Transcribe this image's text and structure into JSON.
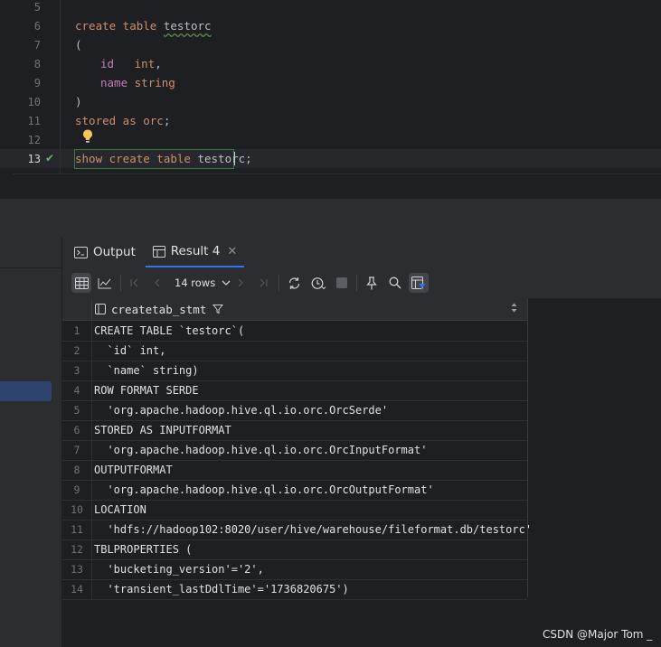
{
  "editor": {
    "line_numbers": [
      "5",
      "6",
      "7",
      "8",
      "9",
      "10",
      "11",
      "12",
      "13"
    ],
    "lines": {
      "l6_kw": "create table ",
      "l6_name": "testorc",
      "l7": "(",
      "l8_col": "id",
      "l8_pad": "   ",
      "l8_type": "int",
      "l8_comma": ",",
      "l9_col": "name",
      "l9_type": "string",
      "l10": ")",
      "l11_kw": "stored as orc",
      "l11_semi": ";",
      "l13_kw": "show create table ",
      "l13_name": "testorc",
      "l13_semi": ";"
    }
  },
  "services": {
    "tabs": [
      {
        "label": "Output"
      },
      {
        "label": "Result 4"
      }
    ],
    "toolbar": {
      "rows_label": "14 rows"
    },
    "grid": {
      "column": "createtab_stmt",
      "rows": [
        {
          "n": "1",
          "v": "CREATE TABLE `testorc`("
        },
        {
          "n": "2",
          "v": "  `id` int,"
        },
        {
          "n": "3",
          "v": "  `name` string)"
        },
        {
          "n": "4",
          "v": "ROW FORMAT SERDE"
        },
        {
          "n": "5",
          "v": "  'org.apache.hadoop.hive.ql.io.orc.OrcSerde'"
        },
        {
          "n": "6",
          "v": "STORED AS INPUTFORMAT"
        },
        {
          "n": "7",
          "v": "  'org.apache.hadoop.hive.ql.io.orc.OrcInputFormat'"
        },
        {
          "n": "8",
          "v": "OUTPUTFORMAT"
        },
        {
          "n": "9",
          "v": "  'org.apache.hadoop.hive.ql.io.orc.OrcOutputFormat'"
        },
        {
          "n": "10",
          "v": "LOCATION"
        },
        {
          "n": "11",
          "v": "  'hdfs://hadoop102:8020/user/hive/warehouse/fileformat.db/testorc'"
        },
        {
          "n": "12",
          "v": "TBLPROPERTIES ("
        },
        {
          "n": "13",
          "v": "  'bucketing_version'='2',"
        },
        {
          "n": "14",
          "v": "  'transient_lastDdlTime'='1736820675')"
        }
      ]
    }
  },
  "watermark": "CSDN @Major Tom _",
  "colors": {
    "keyword": "#cf8e6d",
    "column": "#c77dbb",
    "accent": "#3574f0",
    "success": "#5fb865"
  }
}
